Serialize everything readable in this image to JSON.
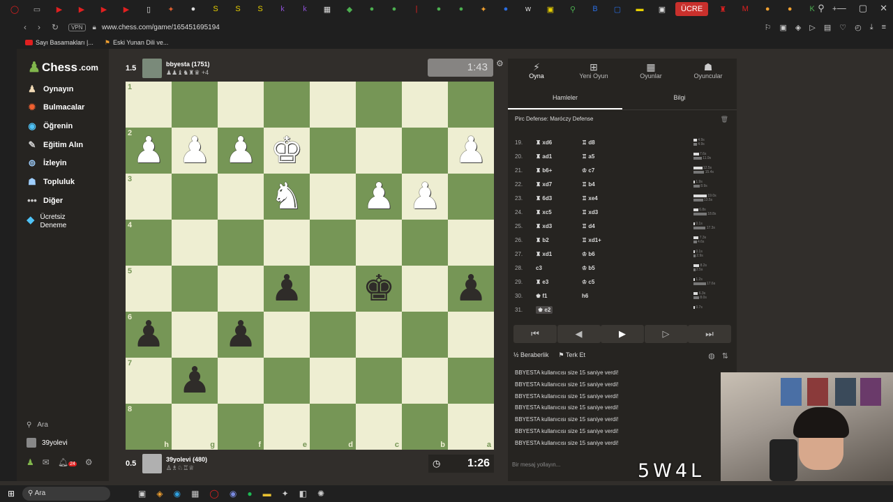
{
  "browser": {
    "tab_active_label": "ÜCRE",
    "url": "www.chess.com/game/165451695194",
    "vpn_label": "VPN",
    "bookmarks": [
      "Sayı Basamakları |...",
      "Eski Yunan Dili ve..."
    ]
  },
  "leftnav": {
    "logo_text": "Chess",
    "logo_suffix": ".com",
    "items": [
      "Oynayın",
      "Bulmacalar",
      "Öğrenin",
      "Eğitim Alın",
      "İzleyin",
      "Topluluk",
      "Diğer"
    ],
    "premium": "Ücretsiz Deneme",
    "search": "Ara",
    "username": "39yolevi",
    "notif_count": "24"
  },
  "top_player": {
    "score": "1.5",
    "name": "bbyesta (1751)",
    "captures": "♟♟♝♞♜♛ +4",
    "clock": "1:43"
  },
  "bottom_player": {
    "score": "0.5",
    "name": "39yolevi (480)",
    "captures": "♙♗♘♖♕",
    "clock": "1:26"
  },
  "board": {
    "ranks": [
      "1",
      "2",
      "3",
      "4",
      "5",
      "6",
      "7",
      "8"
    ],
    "files": [
      "h",
      "g",
      "f",
      "e",
      "d",
      "c",
      "b",
      "a"
    ],
    "position": [
      [
        "",
        "",
        "",
        "",
        "",
        "",
        "",
        ""
      ],
      [
        "wP",
        "wP",
        "wP",
        "wK",
        "",
        "",
        "",
        "wP"
      ],
      [
        "",
        "",
        "",
        "wN",
        "",
        "wP",
        "wP",
        ""
      ],
      [
        "",
        "",
        "",
        "",
        "",
        "",
        "",
        ""
      ],
      [
        "",
        "",
        "",
        "bP",
        "",
        "bK",
        "",
        "bP"
      ],
      [
        "bP",
        "",
        "bP",
        "",
        "",
        "",
        "",
        ""
      ],
      [
        "",
        "bP",
        "",
        "",
        "",
        "",
        "",
        ""
      ],
      [
        "",
        "",
        "",
        "",
        "",
        "",
        "",
        ""
      ]
    ]
  },
  "panel": {
    "tabs": [
      "Oyna",
      "Yeni Oyun",
      "Oyunlar",
      "Oyuncular"
    ],
    "subtabs": [
      "Hamleler",
      "Bilgi"
    ],
    "opening": "Pirc Defense: Maróczy Defense",
    "moves": [
      {
        "n": "19.",
        "w": "♜ xd6",
        "b": "♖ d8",
        "t1": "4.9s",
        "t2": "4.9s"
      },
      {
        "n": "20.",
        "w": "♜ ad1",
        "b": "♖ a5",
        "t1": "7.6s",
        "t2": "11.9s"
      },
      {
        "n": "21.",
        "w": "♜ b6+",
        "b": "♔ c7",
        "t1": "12.5s",
        "t2": "15.4s"
      },
      {
        "n": "22.",
        "w": "♜ xd7",
        "b": "♖ b4",
        "t1": "1.9s",
        "t2": "8.9s"
      },
      {
        "n": "23.",
        "w": "♜ 6d3",
        "b": "♖ xe4",
        "t1": "19.0s",
        "t2": "13.5s"
      },
      {
        "n": "24.",
        "w": "♜ xc5",
        "b": "♖ xd3",
        "t1": "6.8s",
        "t2": "18.8s"
      },
      {
        "n": "25.",
        "w": "♜ xd3",
        "b": "♖ d4",
        "t1": "0.1s",
        "t2": "17.3s"
      },
      {
        "n": "26.",
        "w": "♜ b2",
        "b": "♖ xd1+",
        "t1": "7.3s",
        "t2": "4.6s"
      },
      {
        "n": "27.",
        "w": "♜ xd1",
        "b": "♔ b6",
        "t1": "0.1s",
        "t2": "2.9s"
      },
      {
        "n": "28.",
        "w": "c3",
        "b": "♔ b5",
        "t1": "8.2s",
        "t2": "2.5s"
      },
      {
        "n": "29.",
        "w": "♜ e3",
        "b": "♔ c5",
        "t1": "1.2s",
        "t2": "17.6s"
      },
      {
        "n": "30.",
        "w": "♚ f1",
        "b": "h6",
        "t1": "6.3s",
        "t2": "8.0s"
      },
      {
        "n": "31.",
        "w": "♚ e2",
        "b": "",
        "t1": "0.7s",
        "t2": ""
      }
    ],
    "nav": [
      "⏮",
      "◀",
      "▶",
      "▷",
      "⏭"
    ],
    "draw": "½ Beraberlik",
    "resign": "Terk Et",
    "chat": [
      "BBYESTA kullanıcısı size 15 saniye verdi!",
      "BBYESTA kullanıcısı size 15 saniye verdi!",
      "BBYESTA kullanıcısı size 15 saniye verdi!",
      "BBYESTA kullanıcısı size 15 saniye verdi!",
      "BBYESTA kullanıcısı size 15 saniye verdi!",
      "BBYESTA kullanıcısı size 15 saniye verdi!",
      "BBYESTA kullanıcısı size 15 saniye verdi!"
    ],
    "message_placeholder": "Bir mesaj yollayın..."
  },
  "stream": {
    "stat": "5W4L"
  },
  "taskbar": {
    "search": "Ara"
  }
}
